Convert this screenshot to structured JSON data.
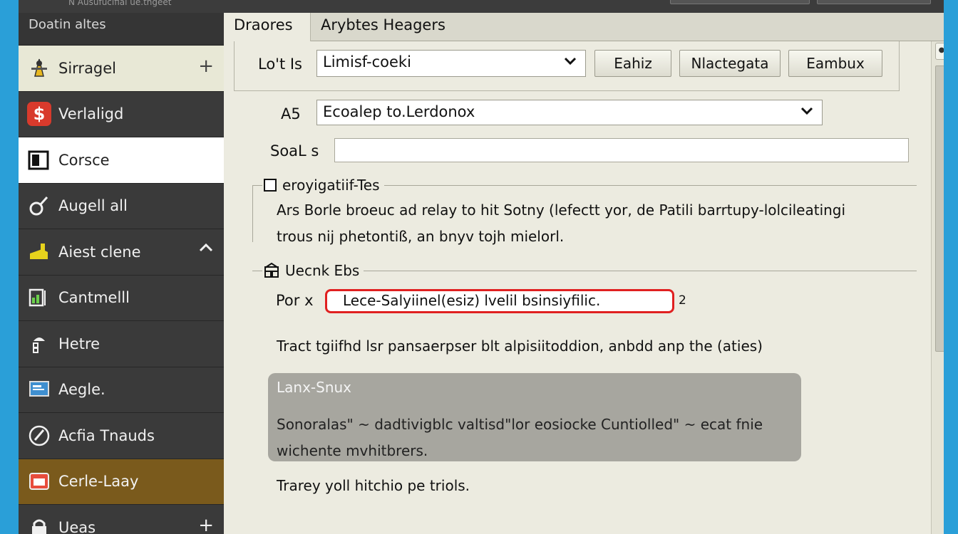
{
  "window": {
    "title": "N Ausufucifial ue.tngeet"
  },
  "sidebar": {
    "header": "Doatin altes",
    "items": [
      {
        "label": "Sirragel",
        "icon": "wizard-icon",
        "trail": "+"
      },
      {
        "label": "Verlaligd",
        "icon": "dollar-icon"
      },
      {
        "label": "Corsce",
        "icon": "console-icon"
      },
      {
        "label": "Augell all",
        "icon": "magnifier-icon"
      },
      {
        "label": "Aiest clene",
        "icon": "disk-icon",
        "trail": "^"
      },
      {
        "label": "Cantmelll",
        "icon": "chart-icon"
      },
      {
        "label": "Hetre",
        "icon": "person-icon"
      },
      {
        "label": "Aegle.",
        "icon": "monitor-icon"
      },
      {
        "label": "Acfia Tnauds",
        "icon": "pen-icon"
      },
      {
        "label": "Cerle-Laay",
        "icon": "calendar-icon"
      },
      {
        "label": "Ueas",
        "icon": "lock-icon",
        "trail": "+"
      }
    ]
  },
  "tabs": [
    "Draores",
    "Arybtes Heagers"
  ],
  "toolbar": {
    "list_label": "Lo't Is",
    "list_value": "Limisf-coeki",
    "buttons": [
      "Eahiz",
      "Nlactegata",
      "Eambux"
    ]
  },
  "form": {
    "as_label": "A5",
    "as_value": "Ecoalep to.Lerdonox",
    "search_label": "SoaL s",
    "search_value": ""
  },
  "group1": {
    "title": "eroyigatiif-Tes",
    "text_line1": "Ars Borle broeuc ad relay to hit Sotny (lefectt yor, de Patili barrtupy-lolcileatingi",
    "text_line2": "trous nij phetontiß, an bnyv tojh mielorl."
  },
  "group2": {
    "title": "Uecnk Ebs",
    "port_label": "Por x",
    "port_value": "Lece-Salyiinel(esiz) lvelil bsinsiyfilic.",
    "port_suffix": "2",
    "note": "Tract tgiifhd lsr pansaerpser blt alpisiitoddion, anbdd anp the (aties)"
  },
  "info": {
    "heading": "Lanx-Snux",
    "body": "Sonoralas\" ~ dadtivigblc valtisd\"lor eosiocke Cuntiolled\" ~ ecat fnie wichente mvhitbrers."
  },
  "footer_text": "Trarey yoll hitchio pe triols."
}
